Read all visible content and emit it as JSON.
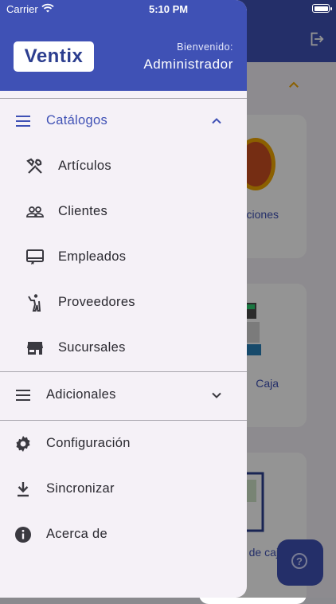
{
  "status_bar": {
    "carrier": "Carrier",
    "time": "5:10 PM"
  },
  "drawer": {
    "logo_text": "Ventix",
    "welcome_label": "Bienvenido:",
    "user_name": "Administrador",
    "catalogos": {
      "label": "Catálogos",
      "expanded": true,
      "items": [
        {
          "label": "Artículos",
          "icon": "tools-icon"
        },
        {
          "label": "Clientes",
          "icon": "people-icon"
        },
        {
          "label": "Empleados",
          "icon": "badge-icon"
        },
        {
          "label": "Proveedores",
          "icon": "person-waving-icon"
        },
        {
          "label": "Sucursales",
          "icon": "store-icon"
        }
      ]
    },
    "adicionales": {
      "label": "Adicionales",
      "expanded": false
    },
    "menu": [
      {
        "label": "Configuración",
        "icon": "gear-icon"
      },
      {
        "label": "Sincronizar",
        "icon": "download-icon"
      },
      {
        "label": "Acerca de",
        "icon": "info-icon"
      }
    ]
  },
  "background": {
    "cards": [
      "ciones",
      "Caja",
      "de caj"
    ]
  },
  "colors": {
    "primary": "#3f51b5",
    "drawer_bg": "#f5f1f7",
    "accent": "#f0a500"
  }
}
